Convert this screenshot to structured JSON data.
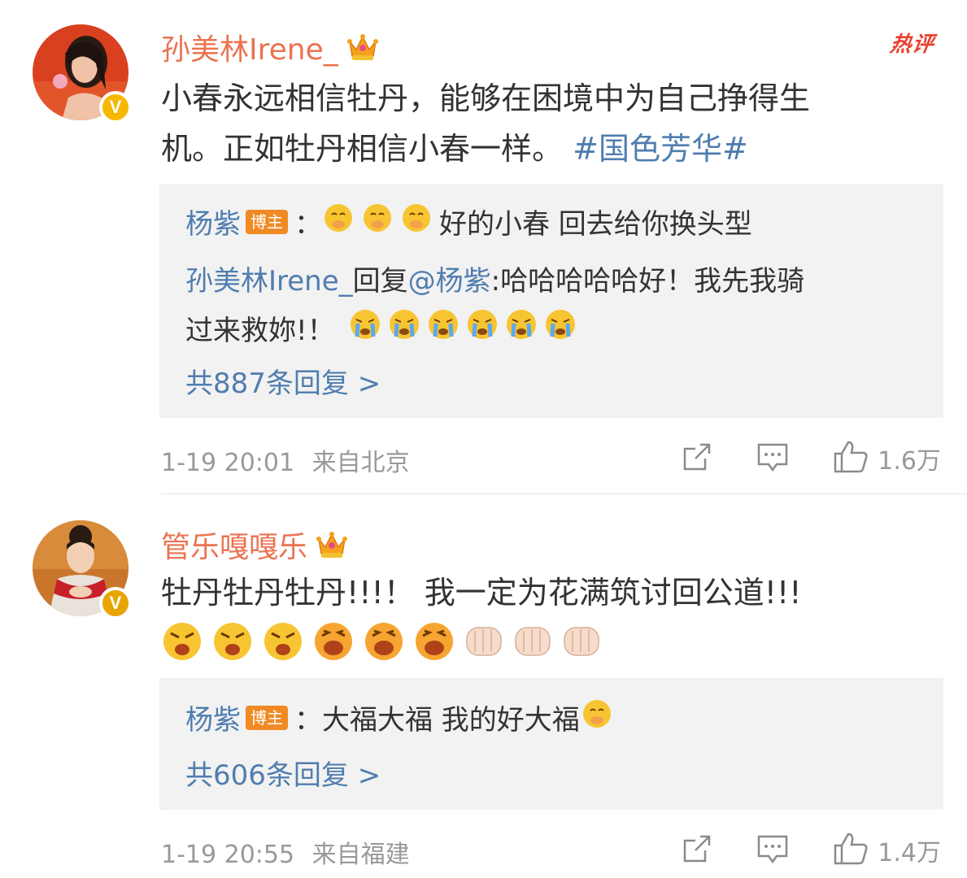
{
  "comments": [
    {
      "username": "孙美林Irene_",
      "hot_tag": "热评",
      "text": "小春永远相信牡丹，能够在困境中为自己挣得生机。正如牡丹相信小春一样。",
      "text_line1": "小春永远相信牡丹，能够在困境中为自己挣得生",
      "text_line2": "机。正如牡丹相信小春一样。",
      "hashtag": "#国色芳华#",
      "replies": [
        {
          "author": "杨紫",
          "badge": "博主",
          "separator": "：",
          "text": "好的小春 回去给你换头型"
        },
        {
          "author": "孙美林Irene_",
          "reply_word": "回复",
          "mention": "@杨紫",
          "text_line1": ":哈哈哈哈哈好！我先我骑",
          "text_line2": "过来救妳!！"
        }
      ],
      "more_replies": "共887条回复 >",
      "timestamp": "1-19 20:01",
      "location": "来自北京",
      "likes": "1.6万"
    },
    {
      "username": "管乐嘎嘎乐",
      "text": "牡丹牡丹牡丹!!!！ 我一定为花满筑讨回公道!!!",
      "replies": [
        {
          "author": "杨紫",
          "badge": "博主",
          "separator": "：",
          "text": "大福大福 我的好大福"
        }
      ],
      "more_replies": "共606条回复 >",
      "timestamp": "1-19 20:55",
      "location": "来自福建",
      "likes": "1.4万"
    }
  ],
  "icons": {
    "share": "share-icon",
    "comment": "comment-icon",
    "like": "thumbs-up-icon",
    "verified": "verified-badge-icon",
    "crown": "crown-icon"
  },
  "colors": {
    "username": "#eb7350",
    "link": "#507daf",
    "meta": "#999999",
    "reply_bg": "#f2f2f2",
    "hot": "#e8402f",
    "badge": "#f08a24"
  }
}
